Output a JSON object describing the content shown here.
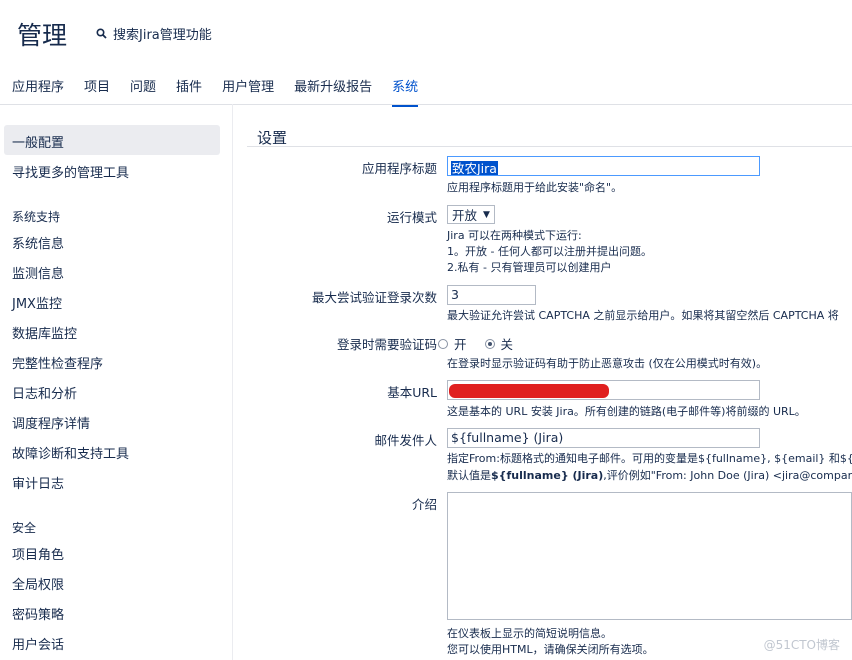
{
  "header": {
    "title": "管理",
    "search_label": "搜索Jira管理功能",
    "tabs": [
      "应用程序",
      "项目",
      "问题",
      "插件",
      "用户管理",
      "最新升级报告",
      "系统"
    ],
    "active_tab": "系统"
  },
  "sidebar": {
    "items_top": [
      "一般配置",
      "寻找更多的管理工具"
    ],
    "section_system": "系统支持",
    "items_system": [
      "系统信息",
      "监测信息",
      "JMX监控",
      "数据库监控",
      "完整性检查程序",
      "日志和分析",
      "调度程序详情",
      "故障诊断和支持工具",
      "审计日志"
    ],
    "section_security": "安全",
    "items_security": [
      "项目角色",
      "全局权限",
      "密码策略",
      "用户会话"
    ]
  },
  "main": {
    "section_title": "设置",
    "app_title": {
      "label": "应用程序标题",
      "value": "致农Jira",
      "desc": "应用程序标题用于给此安装\"命名\"。"
    },
    "mode": {
      "label": "运行模式",
      "value": "开放",
      "desc1": "Jira 可以在两种模式下运行:",
      "desc2": "1。开放 - 任何人都可以注册并提出问题。",
      "desc3": "2.私有 - 只有管理员可以创建用户"
    },
    "max_attempts": {
      "label": "最大尝试验证登录次数",
      "value": "3",
      "desc": "最大验证允许尝试 CAPTCHA 之前显示给用户。如果将其留空然后 CAPTCHA 将"
    },
    "captcha": {
      "label": "登录时需要验证码",
      "option_on": "开",
      "option_off": "关",
      "selected": "关",
      "desc": "在登录时显示验证码有助于防止恶意攻击 (仅在公用模式时有效)。"
    },
    "base_url": {
      "label": "基本URL",
      "desc": "这是基本的 URL 安装 Jira。所有创建的链路(电子邮件等)将前缀的 URL。"
    },
    "email_from": {
      "label": "邮件发件人",
      "value": "${fullname} (Jira)",
      "desc1": "指定From:标题格式的通知电子邮件。可用的变量是${fullname}, ${email} 和${e",
      "desc2_prefix": "默认值是",
      "desc2_bold": "${fullname} (Jira)",
      "desc2_suffix": ",评价例如\"From: John Doe (Jira) <jira@company.c"
    },
    "intro": {
      "label": "介绍",
      "desc1": "在仪表板上显示的简短说明信息。",
      "desc2": "您可以使用HTML，请确保关闭所有选项。"
    }
  },
  "watermark": "@51CTO博客",
  "colors": {
    "accent": "#0052cc",
    "selected_bg": "#ebecf0",
    "redaction": "#e02020"
  }
}
